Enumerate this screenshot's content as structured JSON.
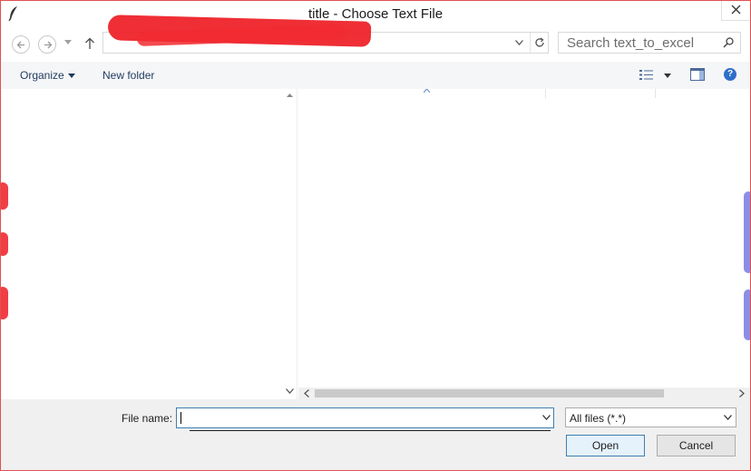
{
  "window": {
    "title": "title - Choose Text File"
  },
  "navigation": {
    "search_placeholder": "Search text_to_excel"
  },
  "toolbar": {
    "organize_label": "Organize",
    "new_folder_label": "New folder"
  },
  "bottom": {
    "file_name_label": "File name:",
    "file_name_value": "",
    "file_type_selected": "All files (*.*)",
    "open_label": "Open",
    "cancel_label": "Cancel"
  },
  "colors": {
    "redaction": "#ee1c24",
    "accent_border": "#3c7fb1",
    "help_icon": "#2f6fc9"
  },
  "icons": [
    "feather-icon",
    "close-icon",
    "back-icon",
    "forward-icon",
    "chevron-down-icon",
    "up-arrow-icon",
    "refresh-icon",
    "search-icon",
    "view-options-icon",
    "preview-pane-icon",
    "help-icon"
  ]
}
